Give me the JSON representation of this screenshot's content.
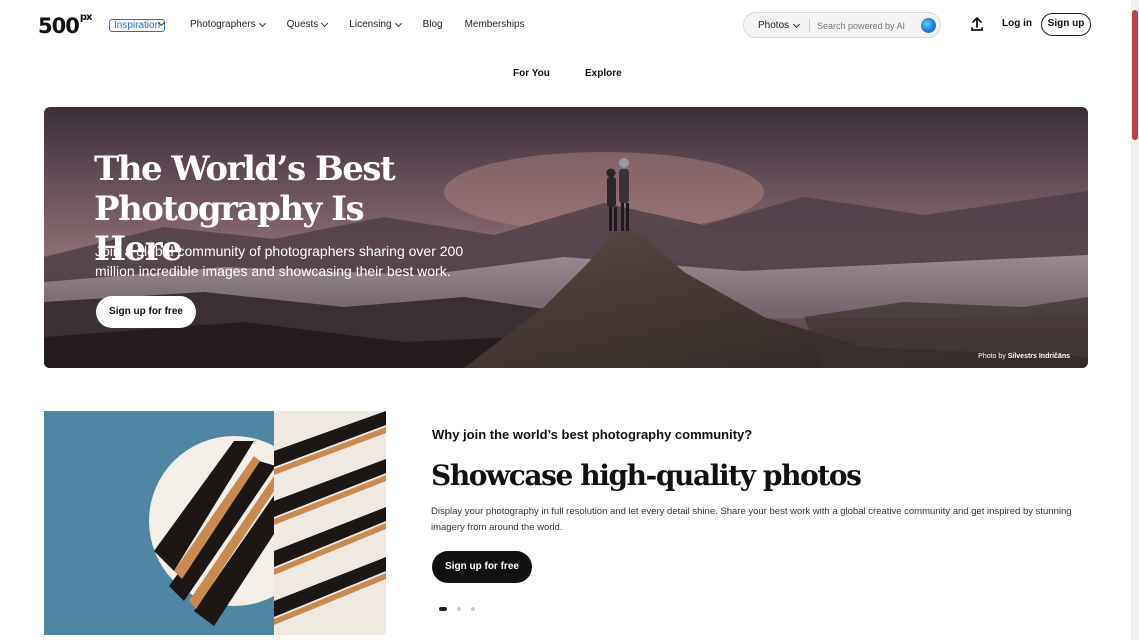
{
  "brand": {
    "logo_text": "500",
    "logo_sup": "px",
    "badge": "Inspiration"
  },
  "nav": {
    "items": [
      {
        "label": "Photographers",
        "has_menu": true
      },
      {
        "label": "Quests",
        "has_menu": true
      },
      {
        "label": "Licensing",
        "has_menu": true
      },
      {
        "label": "Blog",
        "has_menu": false
      },
      {
        "label": "Memberships",
        "has_menu": false
      }
    ]
  },
  "search": {
    "category": "Photos",
    "placeholder": "Search powered by AI",
    "ai_icon": "ai-orb-icon"
  },
  "header_actions": {
    "upload_icon": "upload-icon",
    "login_label": "Log in",
    "signup_label": "Sign up"
  },
  "feed_tabs": {
    "for_you": "For You",
    "explore": "Explore"
  },
  "hero": {
    "title_line1": "The World’s Best",
    "title_line2": "Photography Is Here",
    "subtitle": "Join a global community of photographers sharing over 200 million incredible images and showcasing their best work.",
    "cta_label": "Sign up for free",
    "credit_prefix": "Photo by ",
    "credit_name": "Silvestrs Indričāns"
  },
  "feature": {
    "question": "Why join the world’s best photography community?",
    "title": "Showcase high-quality photos",
    "body": "Display your photography in full resolution and let every detail shine. Share your best work with a global creative community and get inspired by stunning imagery from around the world.",
    "cta_label": "Sign up for free",
    "carousel_active_index": 0,
    "carousel_count": 3
  },
  "colors": {
    "accent_blue": "#2b6ac9",
    "dark": "#111111",
    "feature_bg": "#4e86a4"
  }
}
